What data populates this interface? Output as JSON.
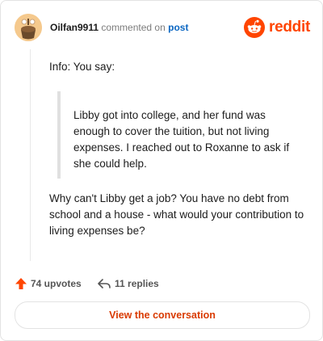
{
  "header": {
    "username": "Oilfan9911",
    "verb": "commented on",
    "target": "post",
    "brand": "reddit"
  },
  "comment": {
    "intro": "Info: You say:",
    "quote": "Libby got into college, and her fund was enough to cover the tuition, but not living expenses. I reached out to Roxanne to ask if she could help.",
    "reply": "Why can't Libby get a job? You have no debt from school and a house - what would your contribution to living expenses be?"
  },
  "actions": {
    "upvotes": "74 upvotes",
    "replies": "11 replies"
  },
  "cta": "View the conversation",
  "colors": {
    "brand": "#ff4500",
    "cta": "#d93a00",
    "link": "#0a66c2"
  },
  "icons": [
    "avatar-icon",
    "reddit-logo-icon",
    "upvote-arrow-icon",
    "reply-arrow-icon"
  ]
}
